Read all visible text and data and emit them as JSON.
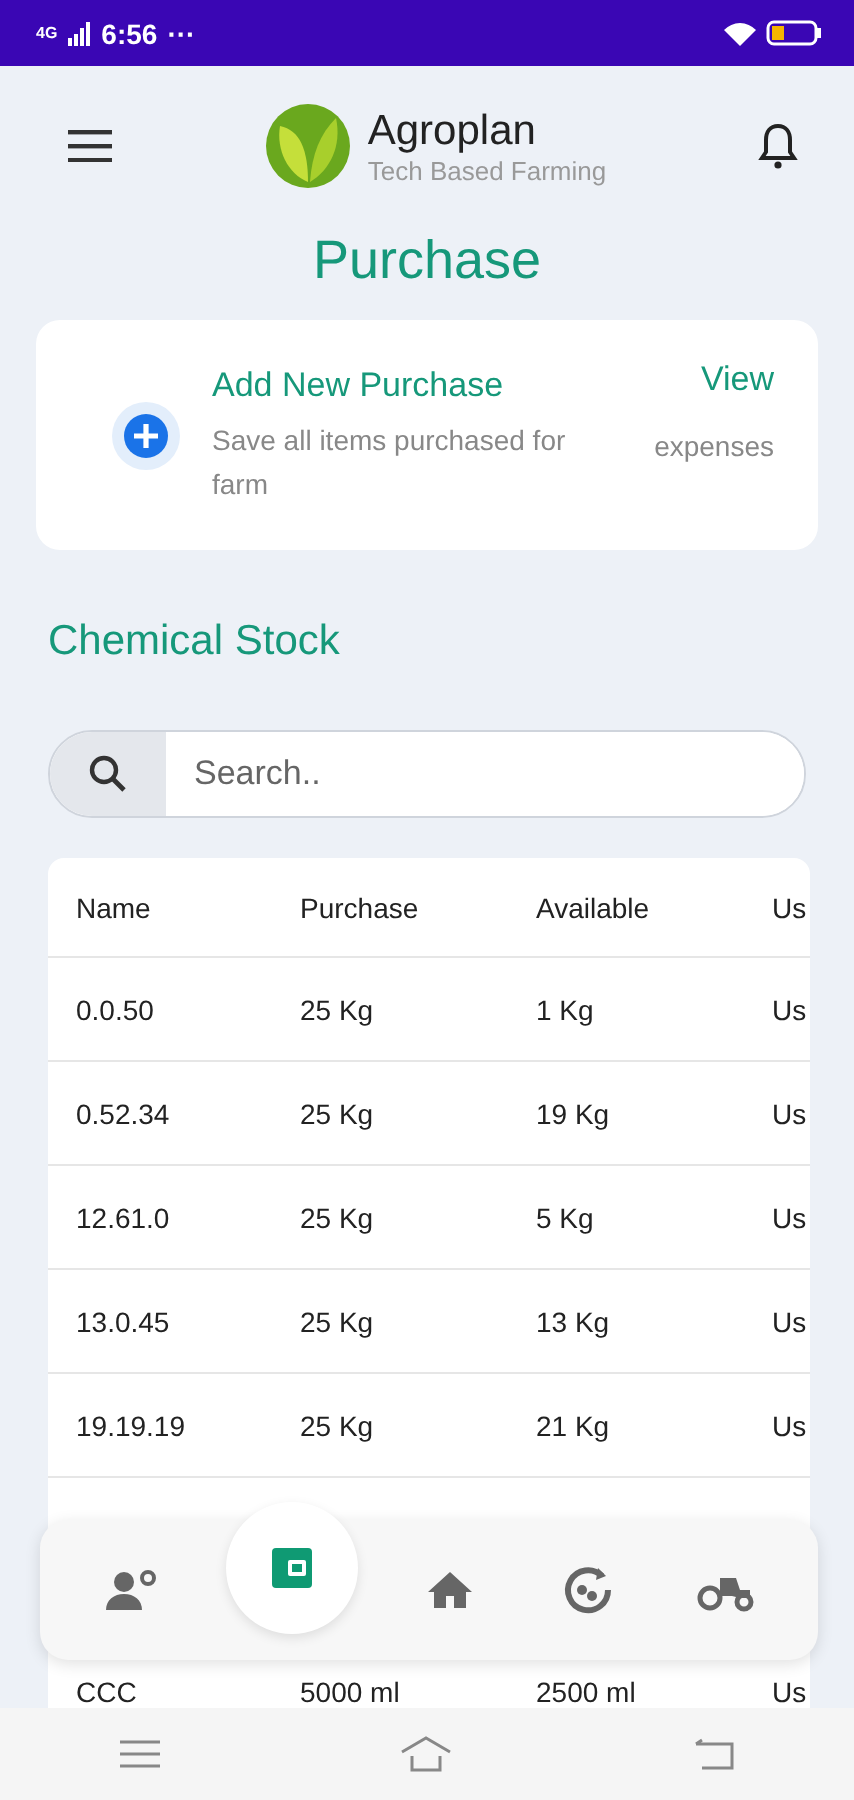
{
  "status_bar": {
    "time": "6:56",
    "more": "···",
    "network": "4G"
  },
  "header": {
    "brand": "Agroplan",
    "tagline": "Tech Based Farming"
  },
  "page_title": "Purchase",
  "action_card": {
    "title": "Add New Purchase",
    "subtitle": "Save all items purchased for farm",
    "link": "View",
    "link_caption": "expenses"
  },
  "section_title": "Chemical Stock",
  "search": {
    "placeholder": "Search.."
  },
  "table": {
    "columns": [
      "Name",
      "Purchase",
      "Available",
      "Us"
    ],
    "rows": [
      [
        "0.0.50",
        "25 Kg",
        "1 Kg",
        "Us"
      ],
      [
        "0.52.34",
        "25 Kg",
        "19 Kg",
        "Us"
      ],
      [
        "12.61.0",
        "25 Kg",
        "5 Kg",
        "Us"
      ],
      [
        "13.0.45",
        "25 Kg",
        "13 Kg",
        "Us"
      ],
      [
        "19.19.19",
        "25 Kg",
        "21 Kg",
        "Us"
      ]
    ],
    "partial_row": [
      "CCC",
      "5000 ml",
      "2500 ml",
      "Us"
    ]
  },
  "bottom_nav": [
    {
      "kind": "workers",
      "selected": false
    },
    {
      "kind": "wallet",
      "selected": true
    },
    {
      "kind": "home",
      "selected": false
    },
    {
      "kind": "harvest",
      "selected": false
    },
    {
      "kind": "tractor",
      "selected": false
    }
  ]
}
